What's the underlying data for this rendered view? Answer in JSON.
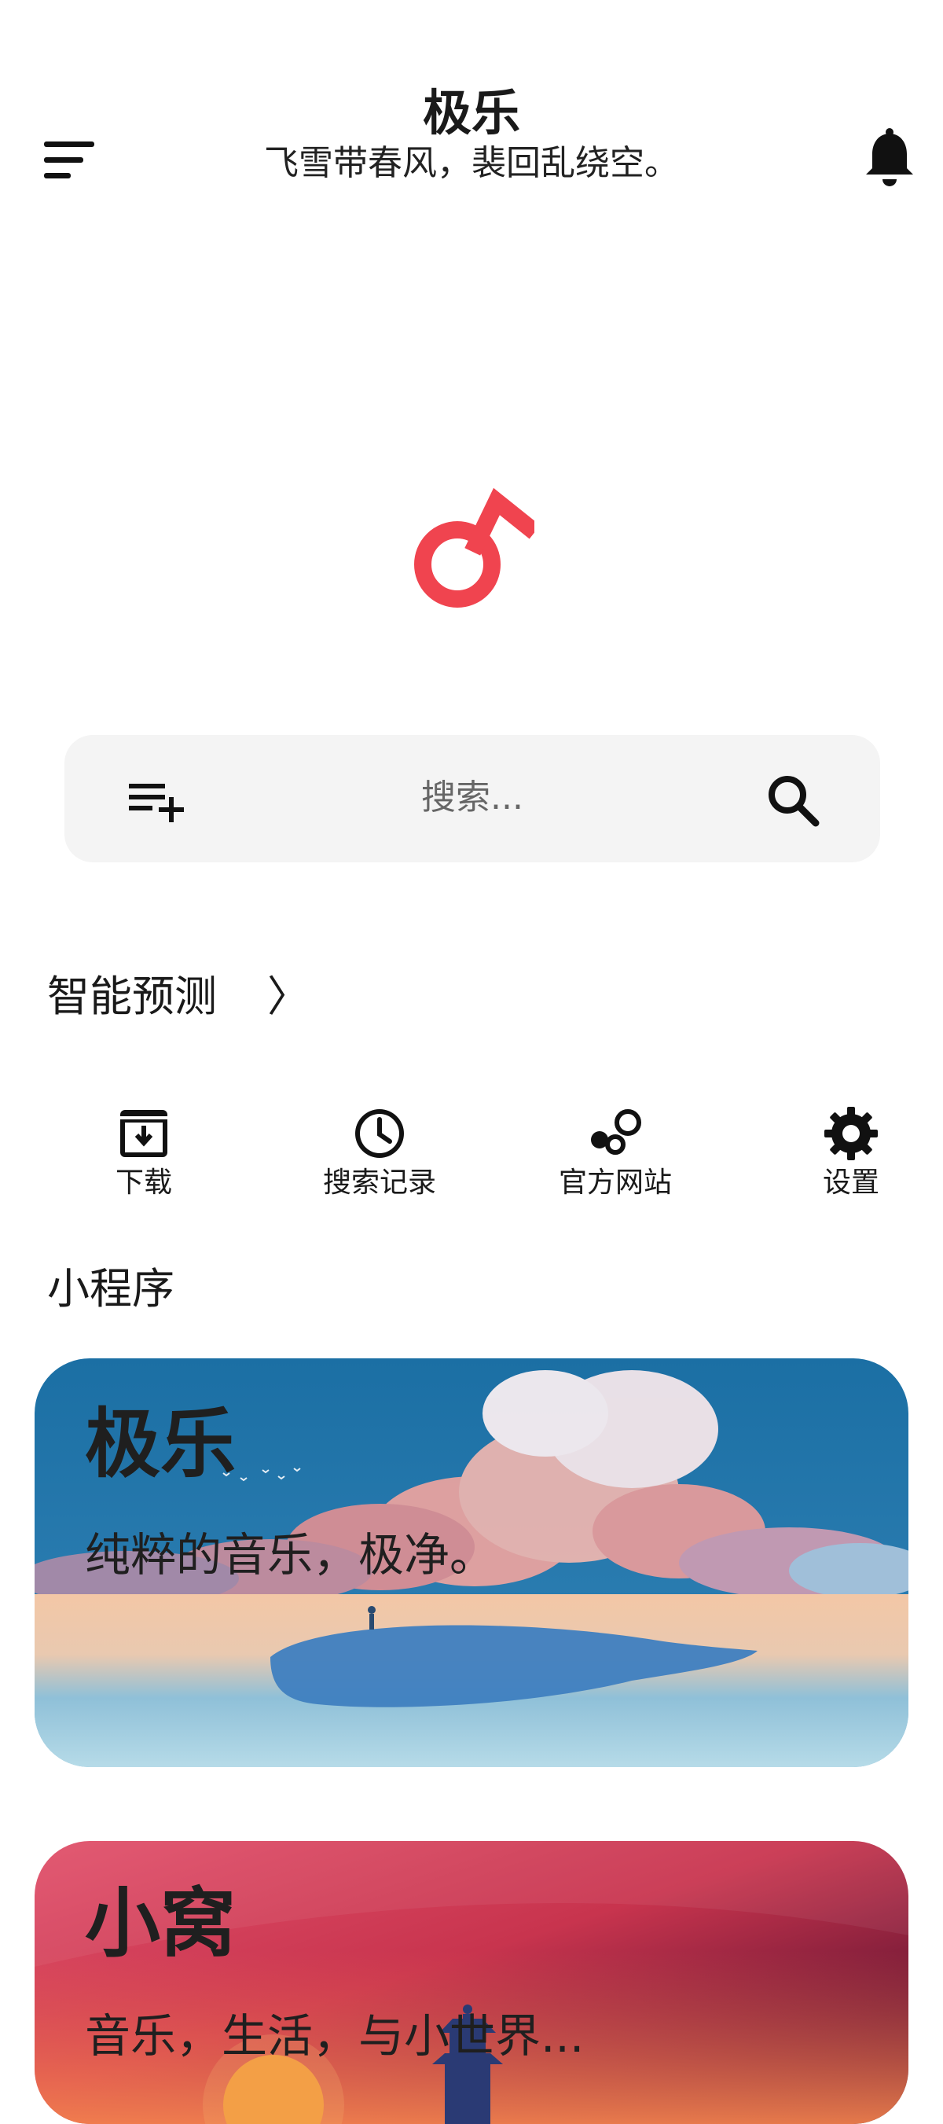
{
  "header": {
    "title": "极乐",
    "subtitle": "飞雪带春风，裴回乱绕空。"
  },
  "search": {
    "placeholder": "搜索..."
  },
  "smart_prediction": {
    "label": "智能预测",
    "chevron": "〉"
  },
  "actions": [
    {
      "label": "下载",
      "icon": "download-box-icon"
    },
    {
      "label": "搜索记录",
      "icon": "clock-icon"
    },
    {
      "label": "官方网站",
      "icon": "bubbles-icon"
    },
    {
      "label": "设置",
      "icon": "gear-icon"
    }
  ],
  "mini_programs": {
    "section_title": "小程序",
    "cards": [
      {
        "title": "极乐",
        "subtitle": "纯粹的音乐，极净。"
      },
      {
        "title": "小窝",
        "subtitle": "音乐，生活，与小世界..."
      }
    ]
  },
  "colors": {
    "accent": "#f0444f",
    "search_bg": "#f4f4f4",
    "card1_sky": "#1f74a8",
    "card2_top": "#c6304f"
  }
}
